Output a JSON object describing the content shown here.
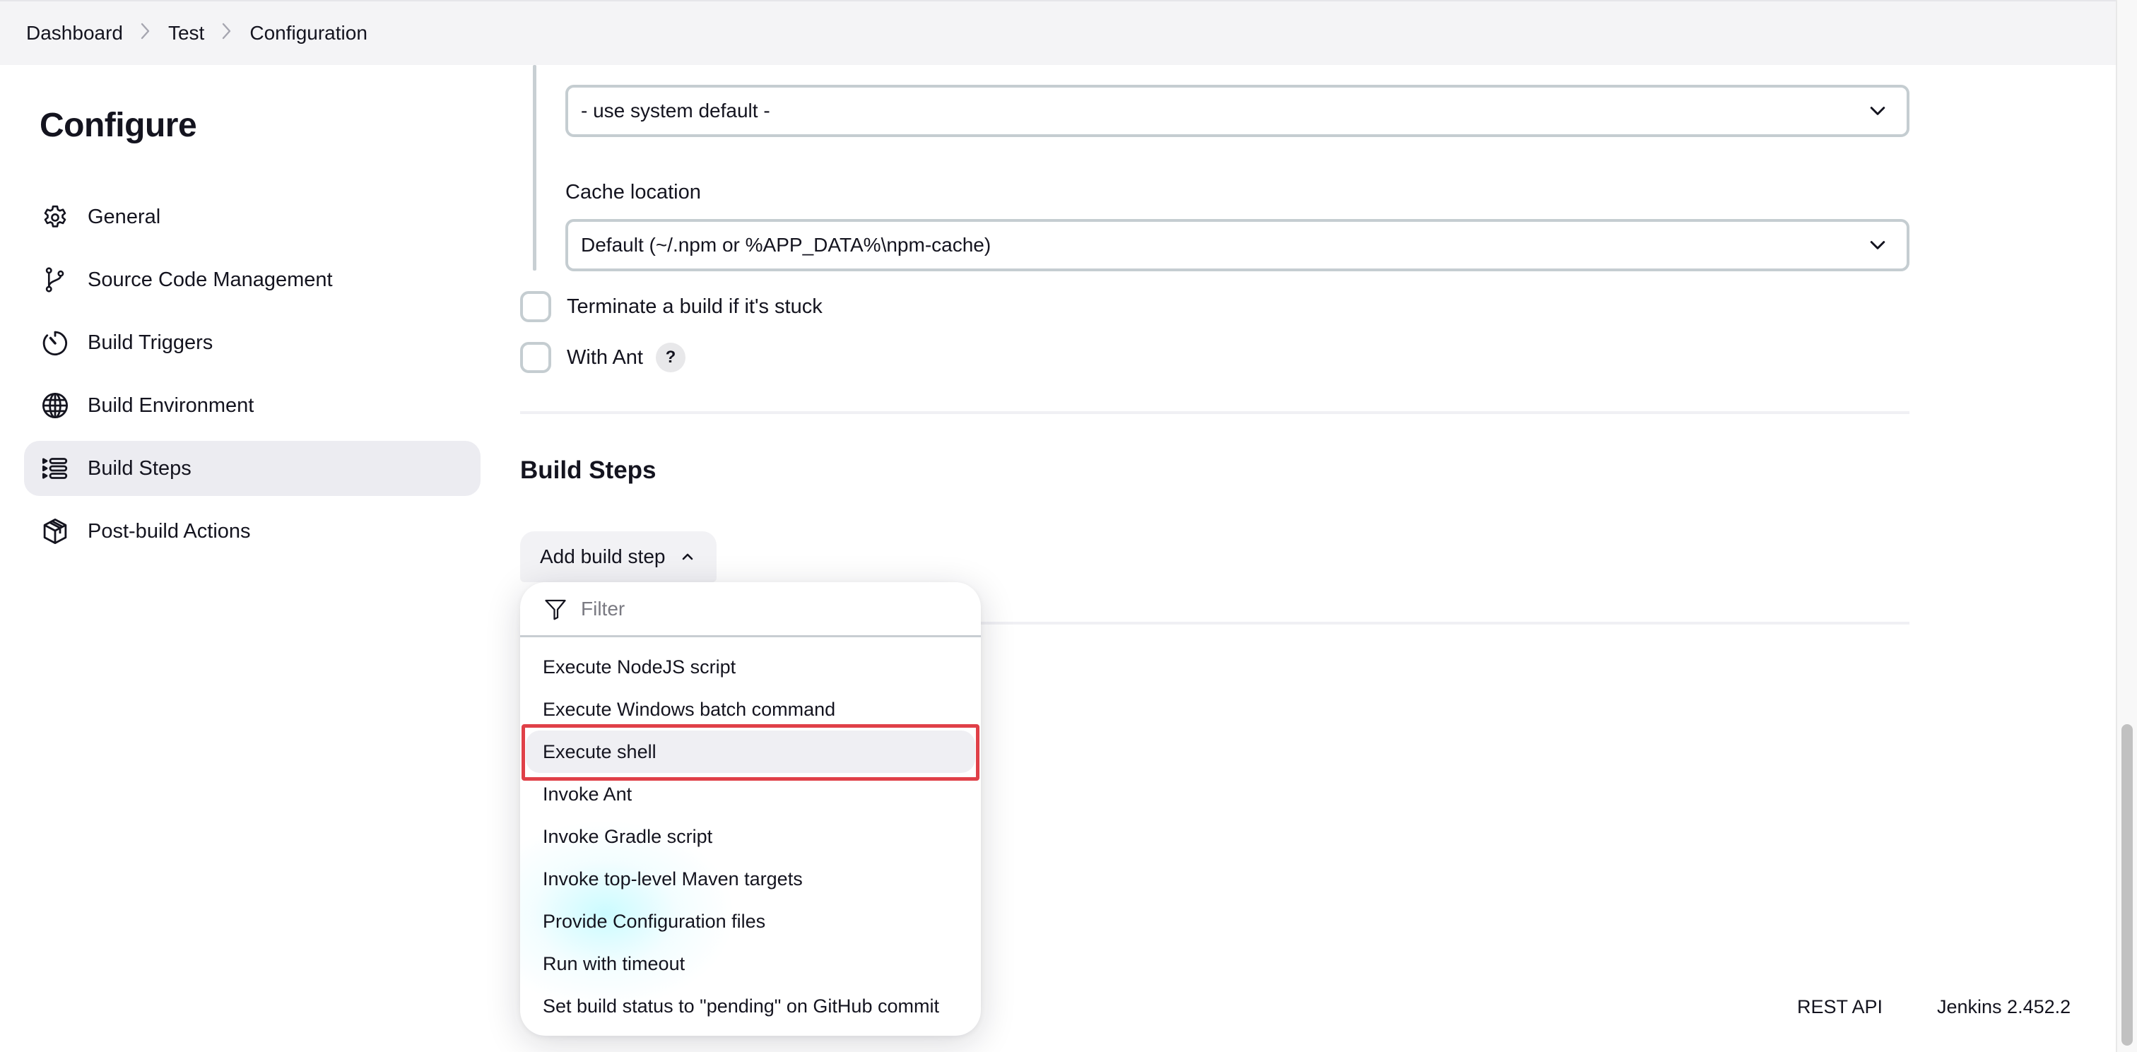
{
  "breadcrumb": {
    "items": [
      "Dashboard",
      "Test",
      "Configuration"
    ],
    "separator_icon": "chevron-right-icon"
  },
  "sidebar": {
    "title": "Configure",
    "items": [
      {
        "label": "General",
        "icon": "gear-icon",
        "active": false
      },
      {
        "label": "Source Code Management",
        "icon": "git-branch-icon",
        "active": false
      },
      {
        "label": "Build Triggers",
        "icon": "timer-icon",
        "active": false
      },
      {
        "label": "Build Environment",
        "icon": "globe-icon",
        "active": false
      },
      {
        "label": "Build Steps",
        "icon": "list-steps-icon",
        "active": true
      },
      {
        "label": "Post-build Actions",
        "icon": "package-icon",
        "active": false
      }
    ]
  },
  "build_environment": {
    "npmrc_select": {
      "value": "- use system default -"
    },
    "cache_location": {
      "label": "Cache location",
      "value": "Default (~/.npm or %APP_DATA%\\npm-cache)"
    },
    "checkboxes": [
      {
        "label": "Terminate a build if it's stuck",
        "checked": false,
        "help": false
      },
      {
        "label": "With Ant",
        "checked": false,
        "help": true
      }
    ],
    "help_label": "?"
  },
  "build_steps": {
    "title": "Build Steps",
    "add_button_label": "Add build step",
    "dropdown": {
      "filter_placeholder": "Filter",
      "items": [
        "Execute NodeJS script",
        "Execute Windows batch command",
        "Execute shell",
        "Invoke Ant",
        "Invoke Gradle script",
        "Invoke top-level Maven targets",
        "Provide Configuration files",
        "Run with timeout",
        "Set build status to \"pending\" on GitHub commit"
      ],
      "highlighted_item": "Execute shell"
    }
  },
  "footer": {
    "rest_api": "REST API",
    "version": "Jenkins 2.452.2"
  },
  "colors": {
    "highlight_border": "#e04048",
    "active_nav_bg": "#ececf1",
    "header_bg": "#f4f4f6"
  }
}
